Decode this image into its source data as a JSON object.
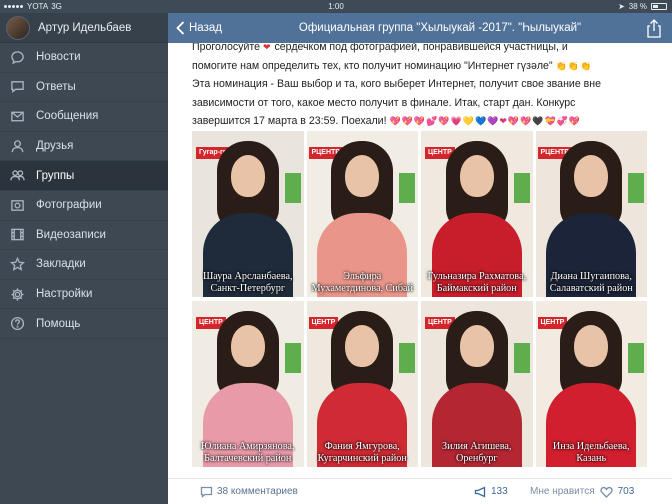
{
  "status_bar": {
    "carrier": "YOTA",
    "network": "3G",
    "time": "1:00",
    "battery": "38 %",
    "battery_level": 0.38
  },
  "sidebar": {
    "profile_name": "Артур Идельбаев",
    "items": [
      {
        "label": "Новости",
        "icon": "news-icon"
      },
      {
        "label": "Ответы",
        "icon": "replies-icon"
      },
      {
        "label": "Сообщения",
        "icon": "messages-icon"
      },
      {
        "label": "Друзья",
        "icon": "friends-icon"
      },
      {
        "label": "Группы",
        "icon": "groups-icon",
        "active": true
      },
      {
        "label": "Фотографии",
        "icon": "photos-icon"
      },
      {
        "label": "Видеозаписи",
        "icon": "videos-icon"
      },
      {
        "label": "Закладки",
        "icon": "bookmarks-icon"
      },
      {
        "label": "Настройки",
        "icon": "settings-icon"
      },
      {
        "label": "Помощь",
        "icon": "help-icon"
      }
    ]
  },
  "header": {
    "back_label": "Назад",
    "title": "Официальная группа \"Хылыукай -2017\". \"Һылыукай\""
  },
  "post": {
    "line1_a": "Проголосуйте",
    "line1_b": "сердечком под фотографией, понравившейся участницы, и",
    "line2": "помогите нам определить тех, кто получит номинацию \"Интернет гүзәле\"",
    "line3": "Эта номинация - Ваш выбор и та, кого выберет Интернет, получит свое звание вне",
    "line4": "зависимости от того, какое место получит в финале. Итак, старт дан. Конкурс",
    "line5": "завершится 17 марта в 23:59. Поехали!",
    "emoji_heart": "❤",
    "emoji_hands": "👏👏👏",
    "emoji_row": "💖💖💖💕💖💗💛💙💜❤💖💖🖤💝💞💖"
  },
  "photos": [
    {
      "caption": "Шаура Арсланбаева, Санкт-Петербург",
      "logo": "Гугар-грудник",
      "dress": "#1f2a3a",
      "bg": "#e9e4dc"
    },
    {
      "caption": "Эльфира Мухаметдинова, Сибай",
      "logo": "РЦЕНТР",
      "dress": "#e9958a",
      "bg": "#f2ede4"
    },
    {
      "caption": "Гульназира Рахматова, Баймакский район",
      "logo": "ЦЕНТР",
      "dress": "#c81d2a",
      "bg": "#efe9e0"
    },
    {
      "caption": "Диана Шугаипова, Салаватский район",
      "logo": "РЦЕНТР",
      "dress": "#1b2438",
      "bg": "#eee6dc"
    },
    {
      "caption": "Юлиана Амирзянова, Балтачевский район",
      "logo": "ЦЕНТР",
      "dress": "#e99aa8",
      "bg": "#f0ebe3"
    },
    {
      "caption": "Фания Ямгурова, Кугарчинский район",
      "logo": "ЦЕНТР",
      "dress": "#d02a34",
      "bg": "#efe8df"
    },
    {
      "caption": "Зилия Агишева, Оренбург",
      "logo": "ЦЕНТР",
      "dress": "#b42632",
      "bg": "#ede6dc"
    },
    {
      "caption": "Инза Идельбаева, Казань",
      "logo": "ЦЕНТР",
      "dress": "#d21f2e",
      "bg": "#f1ebe2"
    }
  ],
  "footer": {
    "comments": "38 комментариев",
    "shares": "133",
    "likes_label": "Мне нравится",
    "likes": "703"
  },
  "colors": {
    "header": "#507299",
    "sidebar": "#3d4853",
    "sidebar_active": "#2b343d",
    "link": "#3f6696"
  }
}
